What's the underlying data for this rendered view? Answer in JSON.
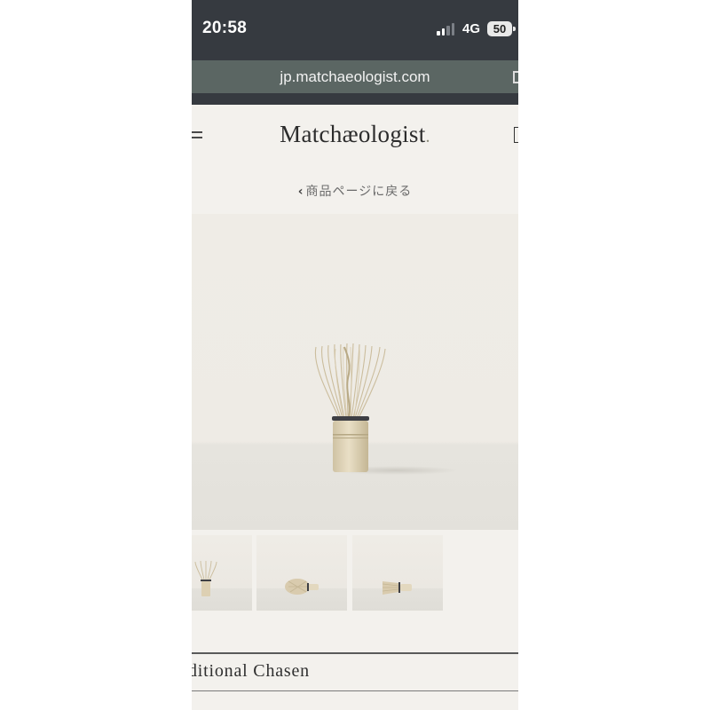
{
  "status_bar": {
    "time": "20:58",
    "network": "4G",
    "battery": "50",
    "signal_bars_filled": 2,
    "signal_bars_total": 4
  },
  "browser": {
    "url": "jp.matchaeologist.com"
  },
  "header": {
    "logo": "Matchæologist",
    "logo_dot": ".",
    "menu_icon": "hamburger-menu-icon",
    "cart_icon": "shopping-bag-icon"
  },
  "back_link": {
    "chevron": "‹",
    "label": "商品ページに戻る"
  },
  "gallery": {
    "main_image": "bamboo-whisk-upright",
    "thumbnails": [
      "bamboo-whisk-upright",
      "bamboo-whisk-lying",
      "bamboo-whisk-lying-side"
    ]
  },
  "product": {
    "title_visible": "ditional Chasen"
  },
  "colors": {
    "status_bar_bg": "#363a40",
    "url_bar_bg": "#5b6663",
    "page_bg": "#f3f1ed"
  }
}
